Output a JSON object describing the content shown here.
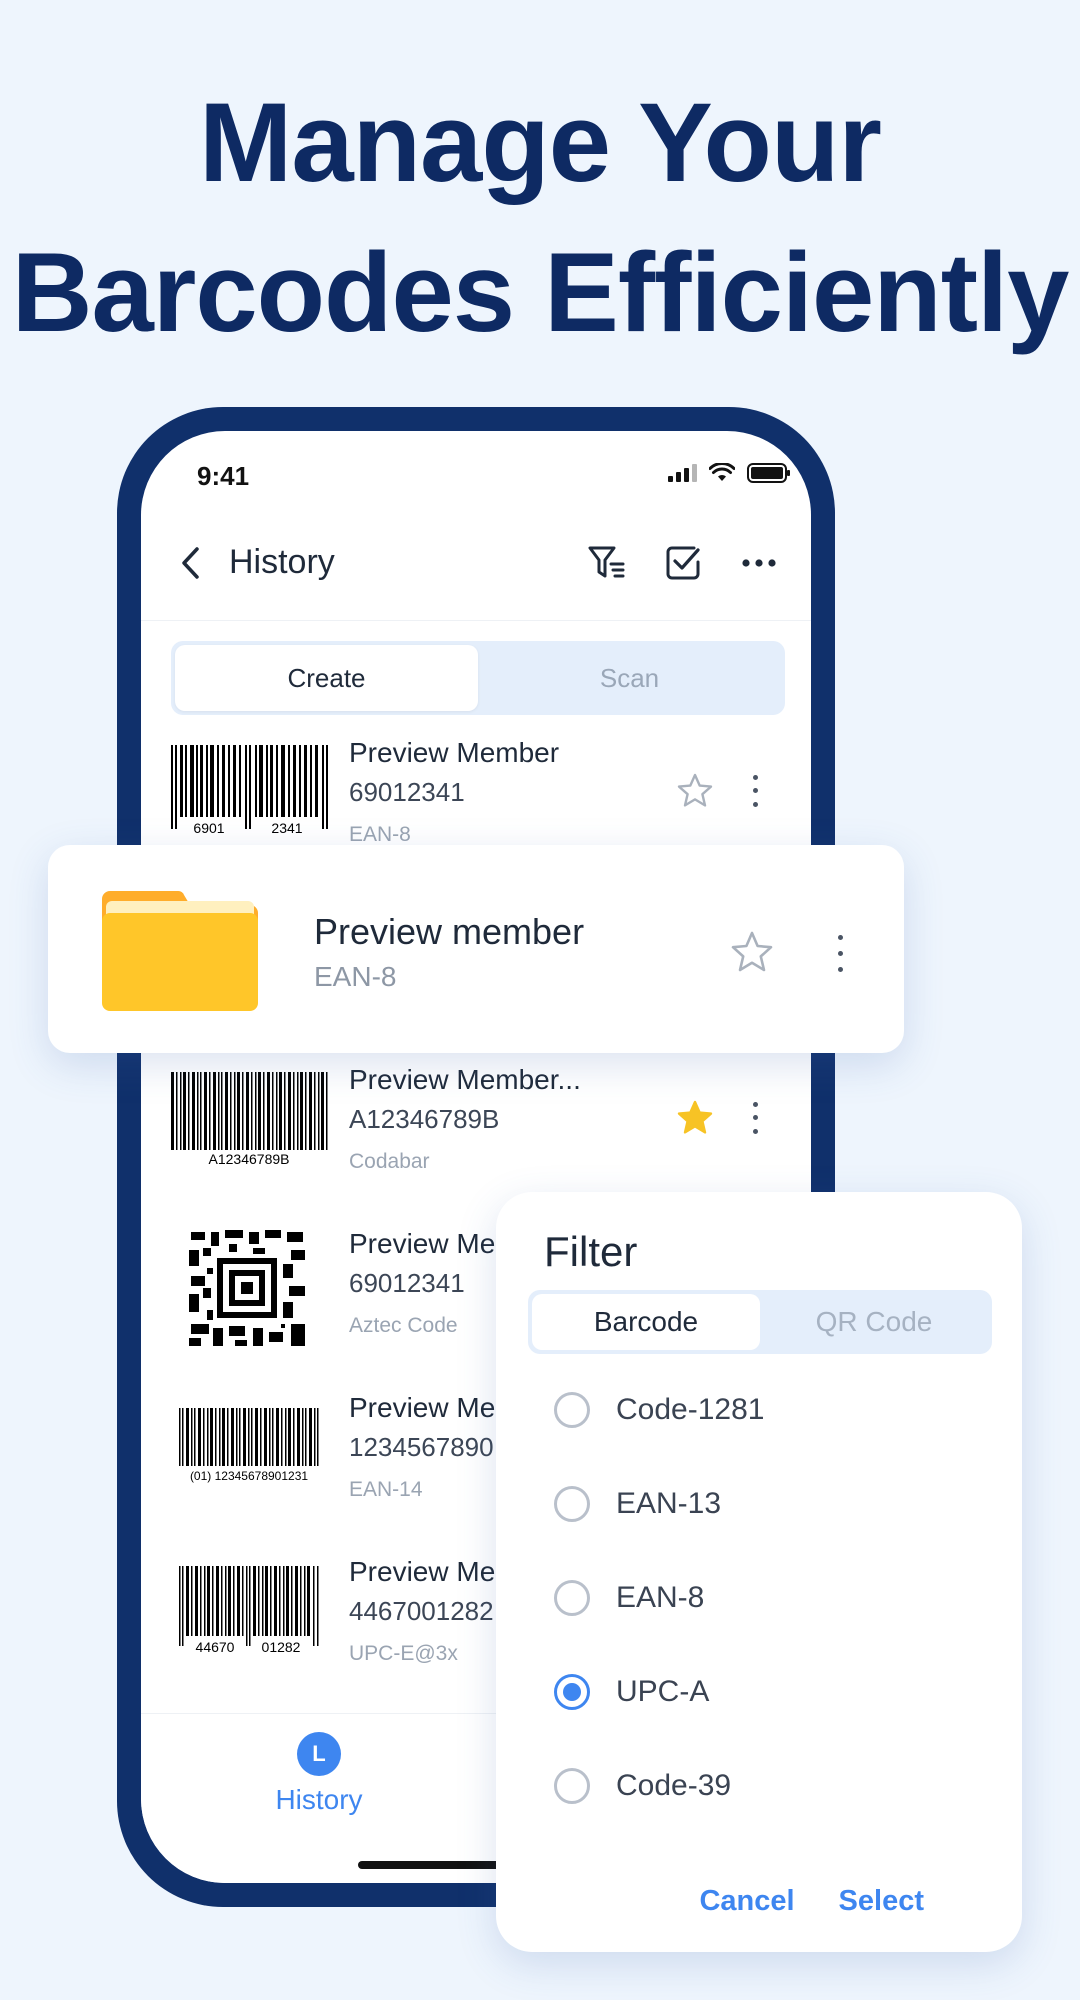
{
  "headline": {
    "line1": "Manage Your",
    "line2": "Barcodes Efficiently"
  },
  "status": {
    "time": "9:41"
  },
  "nav": {
    "title": "History"
  },
  "segment": {
    "create": "Create",
    "scan": "Scan"
  },
  "rows": [
    {
      "title": "Preview Member",
      "value": "69012341",
      "type": "EAN-8",
      "code_text_left": "6901",
      "code_text_right": "2341",
      "starred": false
    },
    {
      "title": "Preview Member...",
      "value": "A12346789B",
      "type": "Codabar",
      "code_text": "A12346789B",
      "starred": true
    },
    {
      "title": "Preview Me",
      "value": "69012341",
      "type": "Aztec Code",
      "starred": false
    },
    {
      "title": "Preview Me",
      "value": "1234567890",
      "type": "EAN-14",
      "code_text": "(01)  12345678901231",
      "starred": false
    },
    {
      "title": "Preview Me",
      "value": "4467001282",
      "type": "UPC-E@3x",
      "code_text_left": "44670",
      "code_text_right": "01282",
      "starred": false
    }
  ],
  "card": {
    "title": "Preview member",
    "subtitle": "EAN-8"
  },
  "tabbar": {
    "history": "History",
    "history_icon": "L"
  },
  "filter": {
    "title": "Filter",
    "tabs": {
      "barcode": "Barcode",
      "qr": "QR Code"
    },
    "options": [
      "Code-1281",
      "EAN-13",
      "EAN-8",
      "UPC-A",
      "Code-39"
    ],
    "selected": "UPC-A",
    "cancel": "Cancel",
    "select": "Select"
  },
  "colors": {
    "brand_navy": "#0e2a63",
    "accent_blue": "#3e86f0",
    "star_gold": "#f7c325",
    "folder_yellow": "#ffc629"
  }
}
